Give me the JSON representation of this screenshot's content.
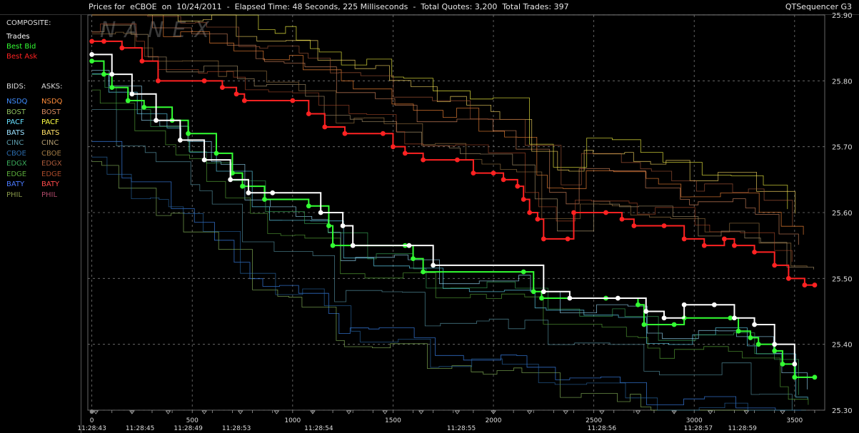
{
  "window": {
    "title": "Prices for  eCBOE  on  10/24/2011  -  Elapsed Time: 48 Seconds, 225 Milliseconds  -  Total Quotes: 3,200  Total Trades: 397",
    "app_name": "QTSequencer G3",
    "watermark": "NANEX"
  },
  "legend": {
    "composite_header": "COMPOSITE:",
    "composite_items": [
      {
        "label": "Trades",
        "color": "#ffffff"
      },
      {
        "label": "Best Bid",
        "color": "#33ff33"
      },
      {
        "label": "Best Ask",
        "color": "#ff2222"
      }
    ],
    "bids_header": "BIDS:",
    "asks_header": "ASKS:",
    "exchanges": [
      {
        "bid": "NSDQ",
        "ask": "NSDQ",
        "bid_color": "#3f8dff",
        "ask_color": "#ff8c3a"
      },
      {
        "bid": "BOST",
        "ask": "BOST",
        "bid_color": "#8fbf5f",
        "ask_color": "#d88a60"
      },
      {
        "bid": "PACF",
        "ask": "PACF",
        "bid_color": "#66e0ff",
        "ask_color": "#ffff44"
      },
      {
        "bid": "BATS",
        "ask": "BATS",
        "bid_color": "#9ae0ff",
        "ask_color": "#ffe066"
      },
      {
        "bid": "CINC",
        "ask": "CINC",
        "bid_color": "#5a9aaa",
        "ask_color": "#b09a70"
      },
      {
        "bid": "CBOE",
        "ask": "CBOE",
        "bid_color": "#2a6aaa",
        "ask_color": "#a07a44"
      },
      {
        "bid": "EDGX",
        "ask": "EDGX",
        "bid_color": "#3aaa5a",
        "ask_color": "#aa5a3a"
      },
      {
        "bid": "EDGE",
        "ask": "EDGE",
        "bid_color": "#5aaa3a",
        "ask_color": "#aa4a2a"
      },
      {
        "bid": "BATY",
        "ask": "BATY",
        "bid_color": "#4a7aff",
        "ask_color": "#ff4a4a"
      },
      {
        "bid": "PHIL",
        "ask": "PHIL",
        "bid_color": "#8a9a4a",
        "ask_color": "#b04a6a"
      }
    ]
  },
  "chart_data": {
    "type": "line",
    "title": "",
    "xlabel": "",
    "ylabel": "",
    "xlim": [
      -20,
      3650
    ],
    "ylim": [
      25.3,
      25.9
    ],
    "grid": true,
    "x_ticks": [
      0,
      500,
      1000,
      1500,
      2000,
      2500,
      3000,
      3500
    ],
    "y_ticks": [
      "25.30",
      "25.40",
      "25.50",
      "25.60",
      "25.70",
      "25.80",
      "25.90"
    ],
    "time_labels": [
      {
        "x": 0,
        "label": "11:28:43"
      },
      {
        "x": 240,
        "label": "11:28:45"
      },
      {
        "x": 480,
        "label": "11:28:49"
      },
      {
        "x": 720,
        "label": "11:28:53"
      },
      {
        "x": 1130,
        "label": "11:28:54"
      },
      {
        "x": 1840,
        "label": "11:28:55"
      },
      {
        "x": 2540,
        "label": "11:28:56"
      },
      {
        "x": 3020,
        "label": "11:28:57"
      },
      {
        "x": 3240,
        "label": "11:28:59"
      }
    ],
    "series": [
      {
        "name": "Best Ask",
        "color": "#ff2222",
        "points": [
          [
            0,
            25.86
          ],
          [
            60,
            25.86
          ],
          [
            150,
            25.85
          ],
          [
            250,
            25.83
          ],
          [
            330,
            25.8
          ],
          [
            560,
            25.8
          ],
          [
            650,
            25.79
          ],
          [
            720,
            25.78
          ],
          [
            760,
            25.77
          ],
          [
            1000,
            25.77
          ],
          [
            1080,
            25.75
          ],
          [
            1160,
            25.73
          ],
          [
            1260,
            25.72
          ],
          [
            1450,
            25.72
          ],
          [
            1500,
            25.7
          ],
          [
            1560,
            25.69
          ],
          [
            1650,
            25.68
          ],
          [
            1820,
            25.68
          ],
          [
            1900,
            25.66
          ],
          [
            2000,
            25.66
          ],
          [
            2050,
            25.65
          ],
          [
            2120,
            25.64
          ],
          [
            2150,
            25.62
          ],
          [
            2180,
            25.6
          ],
          [
            2220,
            25.59
          ],
          [
            2250,
            25.56
          ],
          [
            2370,
            25.56
          ],
          [
            2400,
            25.6
          ],
          [
            2560,
            25.6
          ],
          [
            2640,
            25.59
          ],
          [
            2700,
            25.58
          ],
          [
            2850,
            25.58
          ],
          [
            2950,
            25.56
          ],
          [
            3050,
            25.55
          ],
          [
            3150,
            25.56
          ],
          [
            3200,
            25.55
          ],
          [
            3300,
            25.54
          ],
          [
            3400,
            25.52
          ],
          [
            3470,
            25.5
          ],
          [
            3550,
            25.49
          ],
          [
            3600,
            25.49
          ]
        ]
      },
      {
        "name": "Best Bid",
        "color": "#33ff33",
        "points": [
          [
            0,
            25.83
          ],
          [
            60,
            25.81
          ],
          [
            100,
            25.79
          ],
          [
            180,
            25.77
          ],
          [
            260,
            25.76
          ],
          [
            400,
            25.74
          ],
          [
            480,
            25.72
          ],
          [
            620,
            25.69
          ],
          [
            700,
            25.66
          ],
          [
            750,
            25.64
          ],
          [
            860,
            25.62
          ],
          [
            1080,
            25.61
          ],
          [
            1180,
            25.58
          ],
          [
            1200,
            25.55
          ],
          [
            1560,
            25.55
          ],
          [
            1600,
            25.53
          ],
          [
            1650,
            25.51
          ],
          [
            2150,
            25.51
          ],
          [
            2200,
            25.48
          ],
          [
            2240,
            25.47
          ],
          [
            2560,
            25.47
          ],
          [
            2720,
            25.46
          ],
          [
            2750,
            25.43
          ],
          [
            2900,
            25.43
          ],
          [
            2950,
            25.44
          ],
          [
            3180,
            25.44
          ],
          [
            3220,
            25.42
          ],
          [
            3280,
            25.41
          ],
          [
            3320,
            25.4
          ],
          [
            3400,
            25.39
          ],
          [
            3440,
            25.37
          ],
          [
            3500,
            25.35
          ],
          [
            3600,
            25.35
          ]
        ]
      },
      {
        "name": "Trades",
        "color": "#ffffff",
        "points": [
          [
            0,
            25.84
          ],
          [
            100,
            25.81
          ],
          [
            200,
            25.78
          ],
          [
            320,
            25.74
          ],
          [
            440,
            25.71
          ],
          [
            560,
            25.68
          ],
          [
            690,
            25.65
          ],
          [
            780,
            25.63
          ],
          [
            900,
            25.63
          ],
          [
            1140,
            25.6
          ],
          [
            1250,
            25.58
          ],
          [
            1300,
            25.55
          ],
          [
            1580,
            25.55
          ],
          [
            1700,
            25.52
          ],
          [
            2250,
            25.48
          ],
          [
            2380,
            25.47
          ],
          [
            2620,
            25.47
          ],
          [
            2760,
            25.45
          ],
          [
            2850,
            25.44
          ],
          [
            2950,
            25.46
          ],
          [
            3100,
            25.46
          ],
          [
            3200,
            25.44
          ],
          [
            3300,
            25.43
          ],
          [
            3400,
            25.4
          ],
          [
            3500,
            25.37
          ]
        ]
      }
    ]
  }
}
